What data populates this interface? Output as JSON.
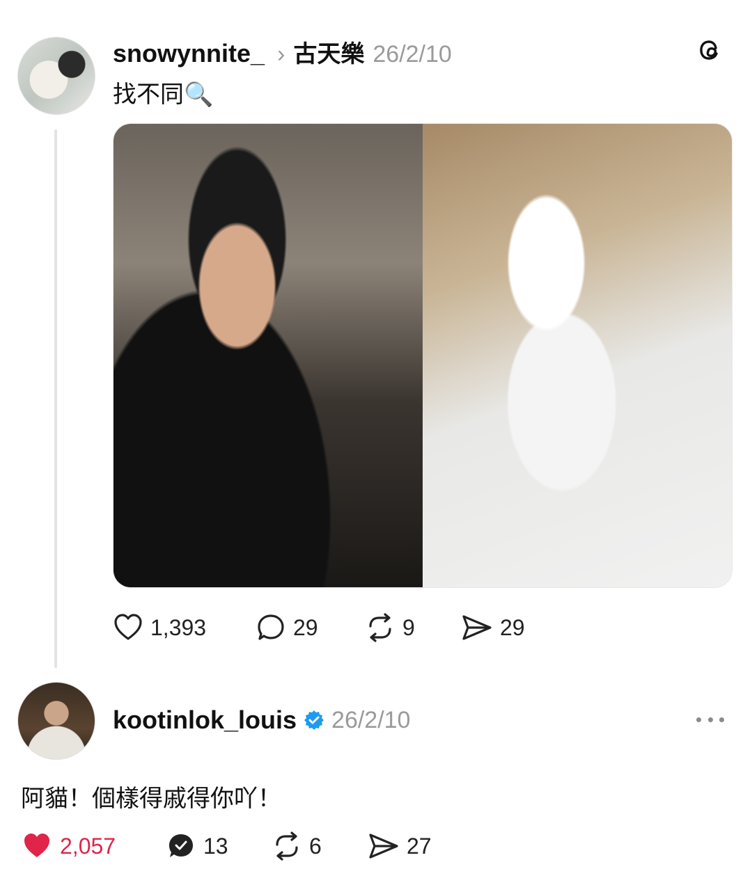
{
  "post": {
    "username": "snowynnite_",
    "reply_to_chevron": "›",
    "reply_to": "古天樂",
    "date": "26/2/10",
    "text": "找不同🔍",
    "actions": {
      "likes": "1,393",
      "comments": "29",
      "reposts": "9",
      "shares": "29"
    }
  },
  "reply": {
    "username": "kootinlok_louis",
    "date": "26/2/10",
    "text": "阿貓！個樣得戚得你吖！",
    "actions": {
      "likes": "2,057",
      "comments": "13",
      "reposts": "6",
      "shares": "27"
    }
  },
  "colors": {
    "like_active": "#e0244a",
    "verified": "#1d9bf0",
    "muted": "#9a9a9a"
  },
  "icons": {
    "app_logo": "threads-logo-icon",
    "more": "more-options-icon"
  }
}
